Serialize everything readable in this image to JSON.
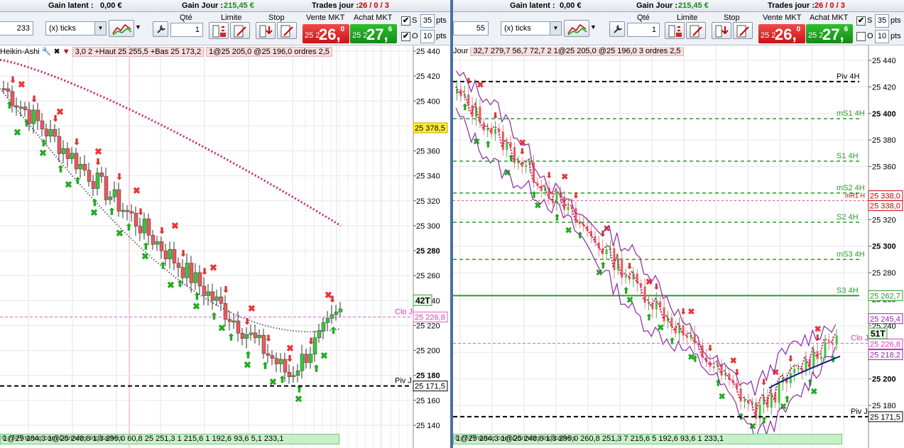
{
  "left": {
    "topbar": {
      "gain_latent_label": "Gain latent :",
      "gain_latent_value": "0,00 €",
      "gain_jour_label": "Gain Jour :",
      "gain_jour_value": "215,45 €",
      "trades_label": "Trades jour :",
      "trades_value": "26 / 0 / 3"
    },
    "controls": {
      "qte_label": "Qté",
      "limite_label": "Limite",
      "stop_label": "Stop",
      "vente_label": "Vente MKT",
      "achat_label": "Achat MKT",
      "interval_value": "233",
      "interval_unit": "(x) ticks",
      "qte_value": "1",
      "sell_small": "25 2",
      "sell_big": "26,",
      "sell_sup": "0",
      "buy_small": "25 2",
      "buy_big": "27,",
      "buy_sup": "6",
      "s_label": "S",
      "s_value": "35",
      "s_unit": "pts",
      "o_label": "O",
      "o_value": "10",
      "o_unit": "pts"
    },
    "header": {
      "indicator": "Heikin-Ashi",
      "text": "1@25 205,0  @25 196,0 ordres 2,5",
      "garbled": "3,0 2 +Haut 25 255,5 +Bas 25 173,2"
    },
    "prices": [
      "25 440",
      "25 420",
      "25 400",
      "25 380",
      "25 360",
      "25 340",
      "25 320",
      "25 300",
      "25 280",
      "25 260",
      "25 240",
      "25 220",
      "25 200",
      "25 180",
      "25 160",
      "25 140"
    ],
    "price_box_current": "25 378,5",
    "price_box_close": "25 226,8",
    "price_box_piv": "25 171,5",
    "timer": "42T",
    "clo_label": "Clo J",
    "piv_label": "Piv J",
    "footer": "1@25 284,3  1@25 248,8  1,3  295,0  60,8  25 251,3  1  215,6  1  192,6  93,6  5,1  233,1",
    "watermark": "© IT-Finance.com  Données indicatives"
  },
  "right": {
    "topbar": {
      "gain_latent_label": "Gain latent :",
      "gain_latent_value": "0,00 €",
      "gain_jour_label": "Gain Jour :",
      "gain_jour_value": "215,45 €",
      "trades_label": "Trades jour :",
      "trades_value": "26 / 0 / 3"
    },
    "controls": {
      "qte_label": "Qté",
      "limite_label": "Limite",
      "stop_label": "Stop",
      "vente_label": "Vente MKT",
      "achat_label": "Achat MKT",
      "interval_value": "55",
      "interval_unit": "(x) ticks",
      "qte_value": "1",
      "sell_small": "25 2",
      "sell_big": "26,",
      "sell_sup": "0",
      "buy_small": "25 2",
      "buy_big": "27,",
      "buy_sup": "6",
      "s_label": "S",
      "s_value": "35",
      "s_unit": "pts",
      "o_label": "O",
      "o_value": "10",
      "o_unit": "pts"
    },
    "header": {
      "indicator": "Jour",
      "text": "32,7  279,7  56,7  72,7  2  1@25 205,0  @25 196,0 3 ordres 2,5"
    },
    "prices": [
      "25 440",
      "25 420",
      "25 400",
      "25 380",
      "25 360",
      "25 340",
      "25 320",
      "25 300",
      "25 280",
      "25 260",
      "25 240",
      "25 220",
      "25 200",
      "25 180"
    ],
    "levels": {
      "piv4h": "Piv 4H",
      "ms1": "mS1 4H",
      "s1": "S1 4H",
      "ms2": "mS2 4H",
      "s2": "S2 4H",
      "ms3": "mS3 4H",
      "s3": "S3 4H",
      "piv_j": "Piv J",
      "clo_j": "Clo J",
      "mr1": "mR1 H"
    },
    "price_boxes": {
      "a": "25 338,0",
      "b": "25 338,0",
      "s3": "25 262,7",
      "up": "25 245,4",
      "close": "25 226,8",
      "low": "25 218,2",
      "piv": "25 171,5"
    },
    "timer": "51T",
    "footer": "1@25 284,3  1@25 248,8  1,3  295,0  260,8  251,3  7  215,6  5  192,6  93,6  1  233,1",
    "watermark": "© IT-Finance.com  Données indicatives"
  },
  "colors": {
    "up_candle": "#3cc43c",
    "down_candle": "#e85a5a",
    "ma_pink": "#d0206a",
    "ma_dark": "#202020",
    "pivot_green": "#2a9a2a"
  }
}
